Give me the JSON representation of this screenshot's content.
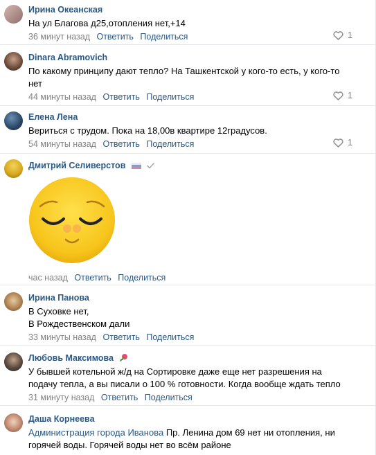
{
  "comments": [
    {
      "author": "Ирина Океанская",
      "lines": [
        "На ул Благова д25,отопления нет,+14"
      ],
      "time": "36 минут назад",
      "reply": "Ответить",
      "share": "Поделиться",
      "likes": "1"
    },
    {
      "author": "Dinara Abramovich",
      "lines": [
        "По какому принципу дают тепло? На Ташкентской у кого-то есть, у кого-то",
        "нет"
      ],
      "time": "44 минуты назад",
      "reply": "Ответить",
      "share": "Поделиться",
      "likes": "1"
    },
    {
      "author": "Елена Лена",
      "lines": [
        "Вериться с трудом. Пока на 18,00в квартире 12градусов."
      ],
      "time": "54 минуты назад",
      "reply": "Ответить",
      "share": "Поделиться",
      "likes": "1"
    },
    {
      "author": "Дмитрий Селиверстов",
      "sticker": "sleepy-smile-sticker",
      "time": "час назад",
      "reply": "Ответить",
      "share": "Поделиться"
    },
    {
      "author": "Ирина Панова",
      "lines": [
        "В Суховке нет,",
        "В Рождественском дали"
      ],
      "time": "33 минуты назад",
      "reply": "Ответить",
      "share": "Поделиться"
    },
    {
      "author": "Любовь Максимова",
      "lines": [
        "У бывшей котельной ж/д на Сортировке даже еще нет разрешения на",
        "подачу тепла, а вы писали о 100 % готовности. Когда вообще ждать тепло"
      ],
      "time": "31 минуту назад",
      "reply": "Ответить",
      "share": "Поделиться"
    },
    {
      "author": "Даша Корнеева",
      "mention": "Администрация города Иванова",
      "lines": [
        " Пр. Ленина дом 69 нет ни отопления, ни",
        "горячей воды. Горячей воды нет во всём районе"
      ]
    }
  ],
  "colors": {
    "link": "#2a5885",
    "meta": "#828282",
    "divider": "#e7e8ec",
    "heart": "#939393",
    "sticker": "#f7c51c"
  }
}
